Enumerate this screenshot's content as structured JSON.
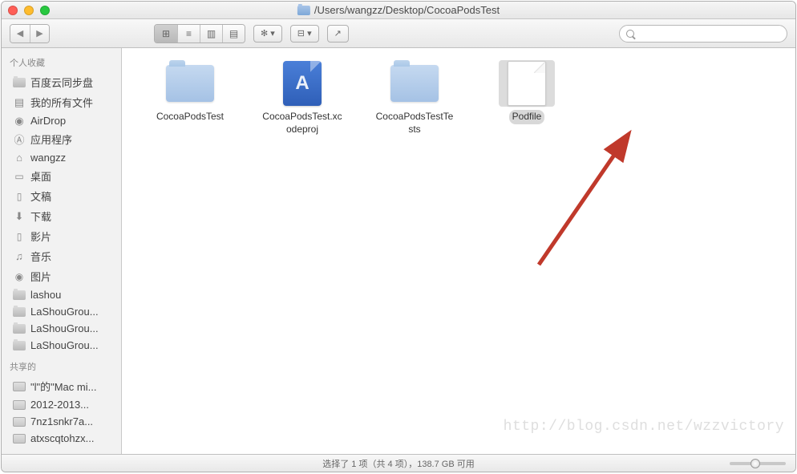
{
  "title_path": "/Users/wangzz/Desktop/CocoaPodsTest",
  "sidebar": {
    "sections": [
      {
        "heading": "个人收藏",
        "items": [
          {
            "label": "百度云同步盘",
            "icon": "folder"
          },
          {
            "label": "我的所有文件",
            "icon": "files"
          },
          {
            "label": "AirDrop",
            "icon": "airdrop"
          },
          {
            "label": "应用程序",
            "icon": "apps"
          },
          {
            "label": "wangzz",
            "icon": "home"
          },
          {
            "label": "桌面",
            "icon": "desktop"
          },
          {
            "label": "文稿",
            "icon": "docs"
          },
          {
            "label": "下载",
            "icon": "downloads"
          },
          {
            "label": "影片",
            "icon": "movies"
          },
          {
            "label": "音乐",
            "icon": "music"
          },
          {
            "label": "图片",
            "icon": "pictures"
          },
          {
            "label": "lashou",
            "icon": "folder"
          },
          {
            "label": "LaShouGrou...",
            "icon": "folder"
          },
          {
            "label": "LaShouGrou...",
            "icon": "folder"
          },
          {
            "label": "LaShouGrou...",
            "icon": "folder"
          }
        ]
      },
      {
        "heading": "共享的",
        "items": [
          {
            "label": "\"l\"的\"Mac mi...",
            "icon": "disk"
          },
          {
            "label": "2012-2013...",
            "icon": "disk"
          },
          {
            "label": "7nz1snkr7a...",
            "icon": "disk"
          },
          {
            "label": "atxscqtohzx...",
            "icon": "disk"
          }
        ]
      }
    ]
  },
  "files": [
    {
      "name": "CocoaPodsTest",
      "type": "folder",
      "selected": false
    },
    {
      "name": "CocoaPodsTest.xcodeproj",
      "type": "xcodeproj",
      "selected": false
    },
    {
      "name": "CocoaPodsTestTests",
      "type": "folder",
      "selected": false
    },
    {
      "name": "Podfile",
      "type": "blank",
      "selected": true
    }
  ],
  "status_text": "选择了 1 项（共 4 项），138.7 GB 可用",
  "watermark": "http://blog.csdn.net/wzzvictory"
}
